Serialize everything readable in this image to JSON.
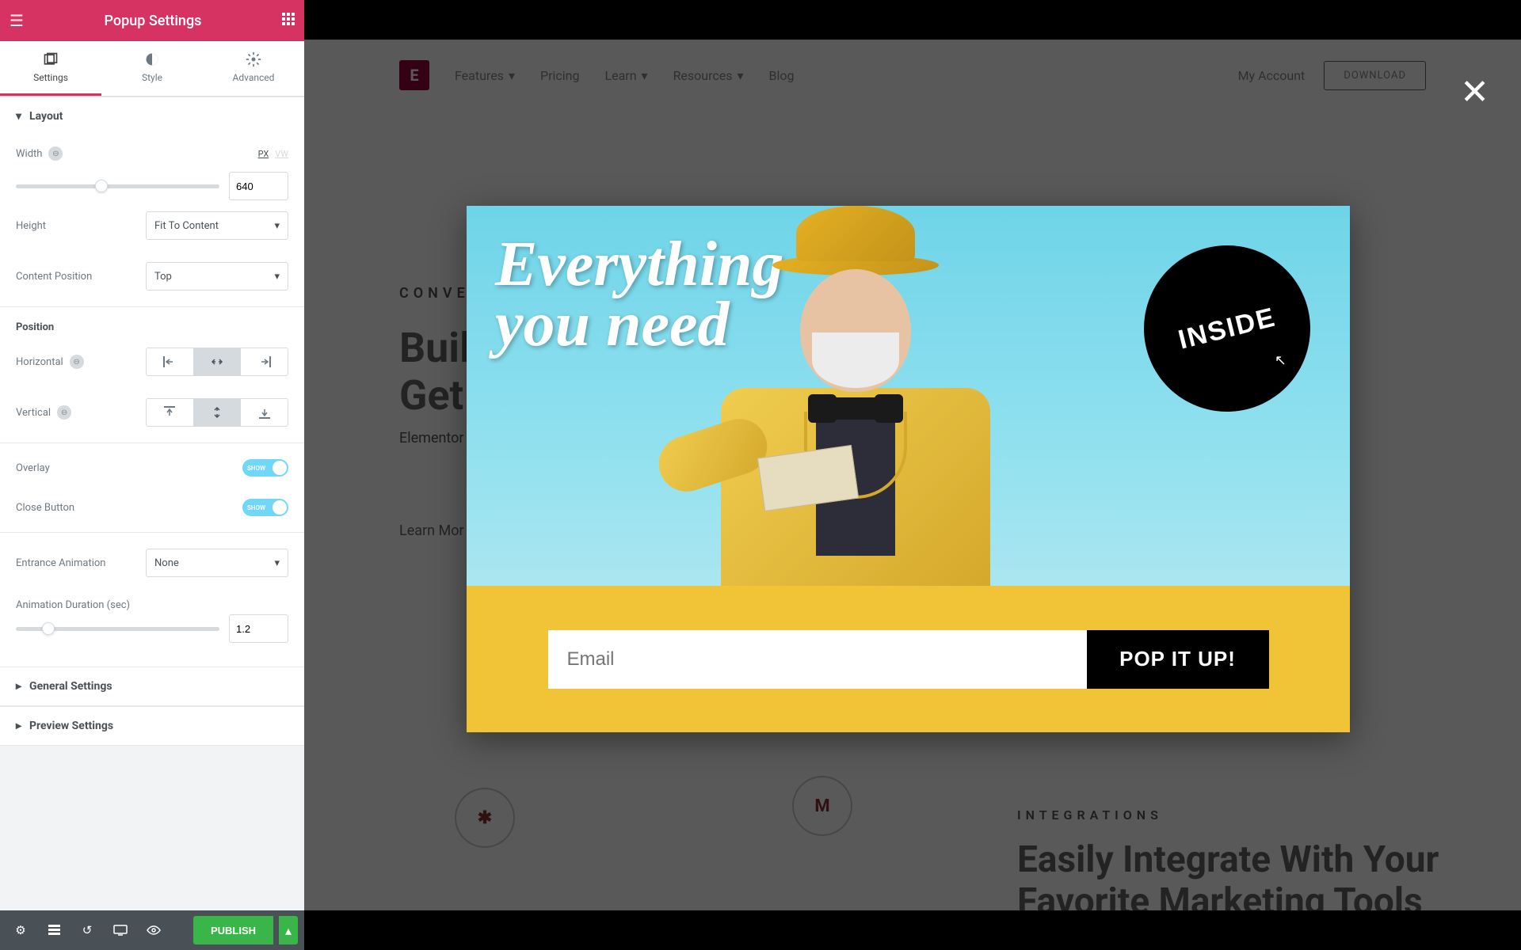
{
  "header": {
    "title": "Popup Settings"
  },
  "tabs": {
    "settings": "Settings",
    "style": "Style",
    "advanced": "Advanced"
  },
  "sections": {
    "layout": "Layout",
    "general": "General Settings",
    "preview": "Preview Settings"
  },
  "layout": {
    "width_label": "Width",
    "width_units": {
      "px": "PX",
      "vw": "VW"
    },
    "width_value": "640",
    "height_label": "Height",
    "height_value": "Fit To Content",
    "content_position_label": "Content Position",
    "content_position_value": "Top",
    "position_label": "Position",
    "horizontal_label": "Horizontal",
    "vertical_label": "Vertical",
    "overlay_label": "Overlay",
    "overlay_toggle": "SHOW",
    "close_button_label": "Close Button",
    "close_button_toggle": "SHOW",
    "entrance_animation_label": "Entrance Animation",
    "entrance_animation_value": "None",
    "animation_duration_label": "Animation Duration (sec)",
    "animation_duration_value": "1.2"
  },
  "footer": {
    "publish": "PUBLISH"
  },
  "site": {
    "nav": {
      "features": "Features",
      "pricing": "Pricing",
      "learn": "Learn",
      "resources": "Resources",
      "blog": "Blog",
      "account": "My Account",
      "download": "DOWNLOAD"
    },
    "section1_tag": "CONVE",
    "section1_h1_a": "Buil",
    "section1_h1_b": "Get",
    "section1_p": "Elementor\nentire buil\ninterfering",
    "section1_link": "Learn Mor",
    "section2_tag": "INTEGRATIONS",
    "section2_h1_a": "Easily Integrate With Your",
    "section2_h1_b": "Favorite Marketing Tools"
  },
  "popup": {
    "headline_a": "Everything",
    "headline_b": "you need",
    "badge": "INSIDE",
    "email_placeholder": "Email",
    "button": "POP IT UP!"
  }
}
